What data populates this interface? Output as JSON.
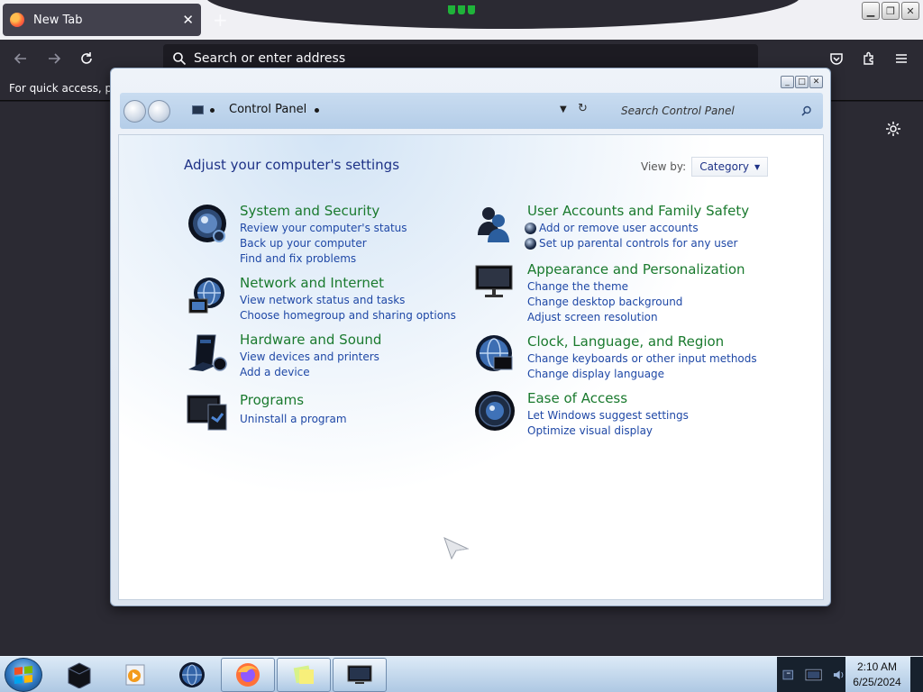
{
  "browser": {
    "tab": {
      "title": "New Tab",
      "close": "✕"
    },
    "new_tab_label": "+",
    "urlbar_placeholder": "Search or enter address",
    "bookmarks_text": "For quick access, plac",
    "window_controls": {
      "minimize": "▁",
      "restore": "❐",
      "close": "✕"
    }
  },
  "control_panel": {
    "breadcrumb": "Control Panel",
    "search_placeholder": "Search Control Panel",
    "heading": "Adjust your computer's settings",
    "view_by_label": "View by:",
    "view_by_value": "Category",
    "categories": [
      {
        "title": "System and Security",
        "icon": "system-security-icon",
        "links": [
          "Review your computer's status",
          "Back up your computer",
          "Find and fix problems"
        ]
      },
      {
        "title": "Network and Internet",
        "icon": "network-internet-icon",
        "links": [
          "View network status and tasks",
          "Choose homegroup and sharing options"
        ]
      },
      {
        "title": "Hardware and Sound",
        "icon": "hardware-sound-icon",
        "links": [
          "View devices and printers",
          "Add a device"
        ]
      },
      {
        "title": "Programs",
        "icon": "programs-icon",
        "links": [
          "Uninstall a program"
        ]
      },
      {
        "title": "User Accounts and Family Safety",
        "icon": "user-accounts-icon",
        "links": [
          "Add or remove user accounts",
          "Set up parental controls for any user"
        ]
      },
      {
        "title": "Appearance and Personalization",
        "icon": "appearance-icon",
        "links": [
          "Change the theme",
          "Change desktop background",
          "Adjust screen resolution"
        ]
      },
      {
        "title": "Clock, Language, and Region",
        "icon": "clock-language-icon",
        "links": [
          "Change keyboards or other input methods",
          "Change display language"
        ]
      },
      {
        "title": "Ease of Access",
        "icon": "ease-of-access-icon",
        "links": [
          "Let Windows suggest settings",
          "Optimize visual display"
        ]
      }
    ]
  },
  "taskbar": {
    "time": "2:10 AM",
    "date": "6/25/2024",
    "items": [
      "explorer-icon",
      "media-player-icon",
      "globe-icon",
      "firefox-icon",
      "sticky-notes-icon",
      "control-panel-icon"
    ]
  },
  "colors": {
    "category_title": "#1a7a2e",
    "link": "#1f48a6",
    "heading": "#1e3287",
    "browser_dark": "#2b2a33"
  }
}
